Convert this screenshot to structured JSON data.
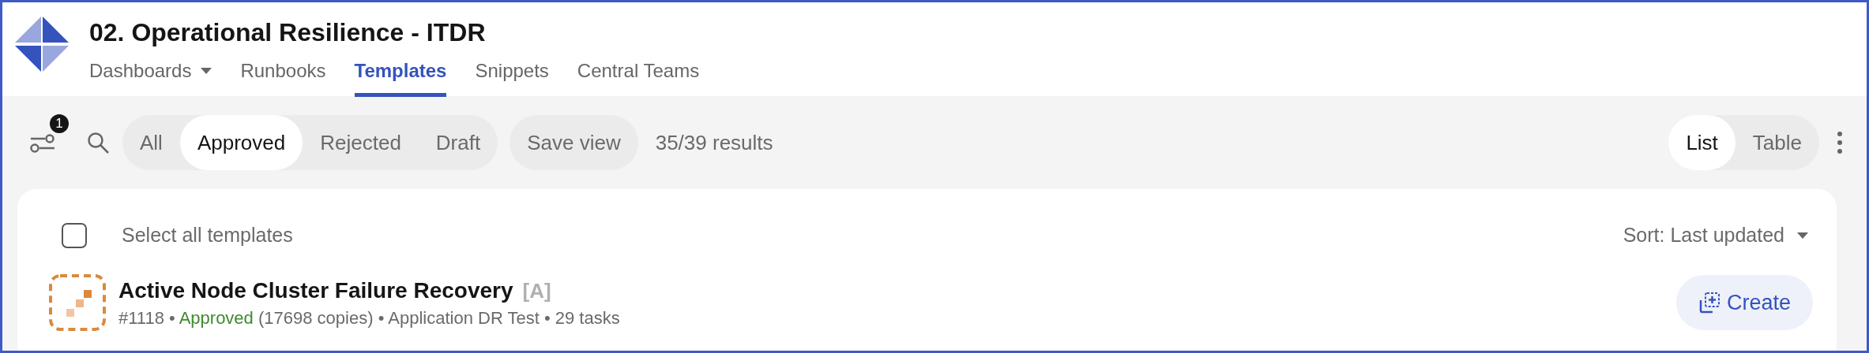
{
  "header": {
    "title": "02. Operational Resilience - ITDR",
    "nav": [
      {
        "label": "Dashboards",
        "kind": "dropdown",
        "selected": false
      },
      {
        "label": "Runbooks",
        "kind": "link",
        "selected": false
      },
      {
        "label": "Templates",
        "kind": "link",
        "selected": true
      },
      {
        "label": "Snippets",
        "kind": "link",
        "selected": false
      },
      {
        "label": "Central Teams",
        "kind": "link",
        "selected": false
      }
    ]
  },
  "toolbar": {
    "filter_badge": "1",
    "status_filters": [
      {
        "label": "All",
        "selected": false
      },
      {
        "label": "Approved",
        "selected": true
      },
      {
        "label": "Rejected",
        "selected": false
      },
      {
        "label": "Draft",
        "selected": false
      }
    ],
    "save_view": "Save view",
    "results": "35/39 results",
    "view_modes": [
      {
        "label": "List",
        "selected": true
      },
      {
        "label": "Table",
        "selected": false
      }
    ]
  },
  "list": {
    "select_all": {
      "label": "Select all templates",
      "checked": false
    },
    "sort": "Sort: Last updated",
    "templates": [
      {
        "title": "Active Node Cluster Failure Recovery",
        "tag": "[A]",
        "number": "#1118",
        "separator": "•",
        "status": "Approved",
        "copies": "(17698 copies)",
        "category": "Application DR Test",
        "tasks": "29 tasks",
        "action": "Create"
      }
    ]
  }
}
